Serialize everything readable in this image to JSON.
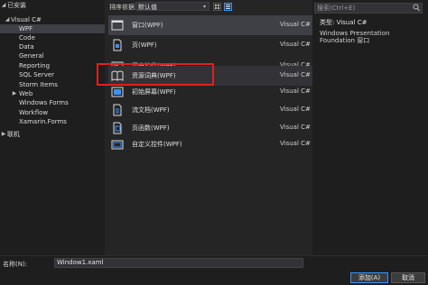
{
  "left_tree": {
    "installed": "已安装",
    "visual_csharp": "Visual C#",
    "items": [
      "WPF",
      "Code",
      "Data",
      "General",
      "Reporting",
      "SQL Server",
      "Storm Items",
      "Web",
      "Windows Forms",
      "Workflow",
      "Xamarin.Forms"
    ],
    "online": "联机"
  },
  "toolbar": {
    "sort_label": "排序依据:",
    "sort_value": "默认值"
  },
  "templates": [
    {
      "name": "窗口(WPF)",
      "lang": "Visual C#",
      "icon": "window-icon"
    },
    {
      "name": "页(WPF)",
      "lang": "Visual C#",
      "icon": "page-icon"
    },
    {
      "name": "用户控件(WPF)",
      "lang": "Visual C#",
      "icon": "user-control-icon"
    },
    {
      "name": "资源词典(WPF)",
      "lang": "Visual C#",
      "icon": "resource-dictionary-icon"
    },
    {
      "name": "初始屏幕(WPF)",
      "lang": "Visual C#",
      "icon": "splash-screen-icon"
    },
    {
      "name": "流文档(WPF)",
      "lang": "Visual C#",
      "icon": "flow-document-icon"
    },
    {
      "name": "页函数(WPF)",
      "lang": "Visual C#",
      "icon": "page-function-icon"
    },
    {
      "name": "自定义控件(WPF)",
      "lang": "Visual C#",
      "icon": "custom-control-icon"
    }
  ],
  "search": {
    "placeholder": "搜索(Ctrl+E)"
  },
  "details": {
    "type_line": "类型: Visual C#",
    "description": "Windows Presentation Foundation 窗口"
  },
  "bottom": {
    "name_label": "名称(N):",
    "name_value": "Window1.xaml",
    "add_button": "添加(A)",
    "cancel_button": "取消"
  },
  "colors": {
    "accent": "#3794ff",
    "highlight": "#e02020",
    "selected_bg": "#3f3f46"
  }
}
